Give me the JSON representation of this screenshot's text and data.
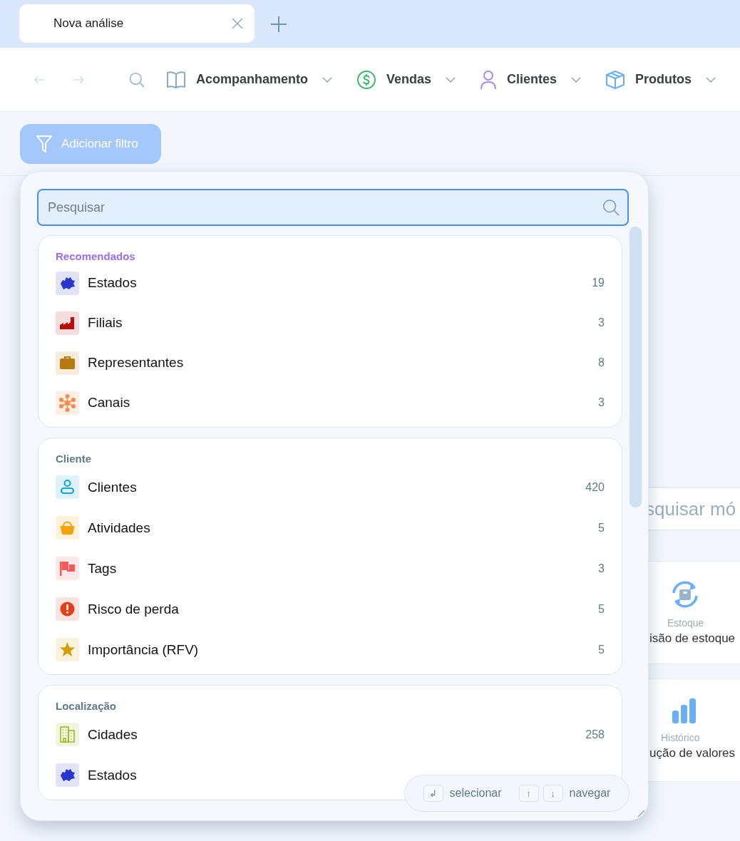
{
  "tab": {
    "title": "Nova análise"
  },
  "nav": {
    "items": [
      {
        "label": "Acompanhamento",
        "kind": "book"
      },
      {
        "label": "Vendas",
        "kind": "dollar"
      },
      {
        "label": "Clientes",
        "kind": "user"
      },
      {
        "label": "Produtos",
        "kind": "box"
      }
    ]
  },
  "filter_button": {
    "label": "Adicionar filtro"
  },
  "module_search": {
    "placeholder": "squisar mó"
  },
  "modules": [
    {
      "category": "Estoque",
      "title": "isão de estoque",
      "kind": "stock"
    },
    {
      "category": "Histórico",
      "title": "ução de valores",
      "kind": "chart"
    }
  ],
  "filter_menu": {
    "search": {
      "placeholder": "Pesquisar"
    },
    "groups": [
      {
        "title": "Recomendados",
        "kind": "recommended",
        "items": [
          {
            "label": "Estados",
            "count": "19",
            "kind": "map"
          },
          {
            "label": "Filiais",
            "count": "3",
            "kind": "factory"
          },
          {
            "label": "Representantes",
            "count": "8",
            "kind": "briefcase"
          },
          {
            "label": "Canais",
            "count": "3",
            "kind": "network"
          }
        ]
      },
      {
        "title": "Cliente",
        "kind": "category",
        "items": [
          {
            "label": "Clientes",
            "count": "420",
            "kind": "user"
          },
          {
            "label": "Atividades",
            "count": "5",
            "kind": "basket"
          },
          {
            "label": "Tags",
            "count": "3",
            "kind": "flag"
          },
          {
            "label": "Risco de perda",
            "count": "5",
            "kind": "alert"
          },
          {
            "label": "Importância (RFV)",
            "count": "5",
            "kind": "star"
          }
        ]
      },
      {
        "title": "Localização",
        "kind": "category",
        "items": [
          {
            "label": "Cidades",
            "count": "258",
            "kind": "building"
          },
          {
            "label": "Estados",
            "kind": "map"
          }
        ]
      }
    ],
    "hints": [
      {
        "keys": [
          "↲"
        ],
        "label": "selecionar"
      },
      {
        "keys": [
          "↑",
          "↓"
        ],
        "label": "navegar"
      }
    ]
  }
}
